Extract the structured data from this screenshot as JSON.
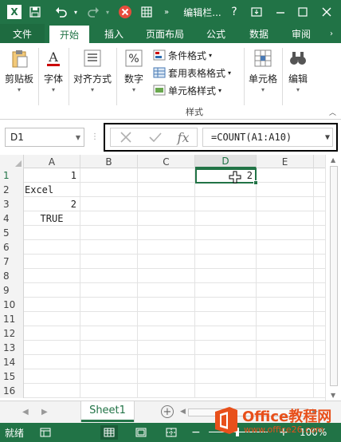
{
  "titlebar": {
    "title": "编辑栏...",
    "help": "?",
    "bg": "#217346"
  },
  "tabs": [
    {
      "label": "文件",
      "id": "file"
    },
    {
      "label": "开始",
      "id": "home"
    },
    {
      "label": "插入",
      "id": "insert"
    },
    {
      "label": "页面布局",
      "id": "page-layout"
    },
    {
      "label": "公式",
      "id": "formulas"
    },
    {
      "label": "数据",
      "id": "data"
    },
    {
      "label": "审阅",
      "id": "review"
    }
  ],
  "ribbon": {
    "clipboard": "剪贴板",
    "font": "字体",
    "font_icon_glyph": "A",
    "alignment": "对齐方式",
    "number": "数字",
    "number_icon_glyph": "%",
    "conditional_format": "条件格式",
    "table_format": "套用表格格式",
    "cell_styles": "单元格样式",
    "styles_group": "样式",
    "cells": "单元格",
    "editing": "编辑"
  },
  "formula_bar": {
    "name_box": "D1",
    "fx": "fx",
    "formula": "=COUNT(A1:A10)"
  },
  "grid": {
    "columns": [
      "A",
      "B",
      "C",
      "D",
      "E"
    ],
    "selected_column": "D",
    "selected_row": "1",
    "rows": [
      "1",
      "2",
      "3",
      "4",
      "5",
      "6",
      "7",
      "8",
      "9",
      "10",
      "11",
      "12",
      "13",
      "14",
      "15",
      "16"
    ],
    "cells": {
      "A1": "1",
      "A2": "Excel",
      "A3": "2",
      "A4": "TRUE",
      "D1": "2"
    }
  },
  "sheets": {
    "active": "Sheet1",
    "add": "+"
  },
  "status": {
    "ready": "就绪",
    "zoom": "100%"
  },
  "watermark": {
    "brand": "Office教程网",
    "url": "www.office26.com"
  },
  "colors": {
    "accent": "#217346",
    "watermark": "#e8501b"
  }
}
